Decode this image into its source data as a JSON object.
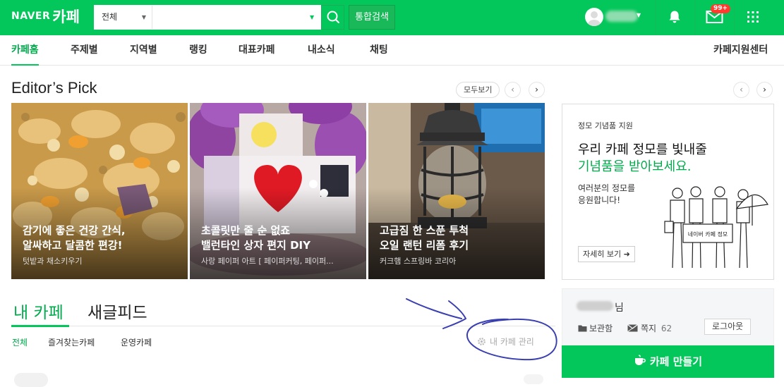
{
  "header": {
    "logo_naver": "NAVER",
    "logo_cafe": "카페",
    "search_category": "전체",
    "search_placeholder": "",
    "unified_search": "통합검색",
    "notification_badge": "99+",
    "brand_color": "#03c75a"
  },
  "nav": {
    "items": [
      "카페홈",
      "주제별",
      "지역별",
      "랭킹",
      "대표카페",
      "내소식",
      "채팅"
    ],
    "right": "카페지원센터"
  },
  "editors_pick": {
    "title": "Editor’s Pick",
    "view_all": "모두보기",
    "cards": [
      {
        "line1": "감기에 좋은 건강 간식,",
        "line2": "알싸하고 달콤한 편강!",
        "source": "텃밭과 채소키우기"
      },
      {
        "line1": "초콜릿만 줄 순 없죠",
        "line2": "밸런타인 상자 편지 DIY",
        "source": "사랑 페이퍼 아트 [ 페이퍼커팅, 페이퍼..."
      },
      {
        "line1": "고급짐 한 스푼 투척",
        "line2": "오일 랜턴 리폼 후기",
        "source": "커크햄 스프링바 코리아"
      }
    ]
  },
  "my_cafe": {
    "tab_mine": "내 카페",
    "tab_feed": "새글피드",
    "sub_tabs": [
      "전체",
      "즐겨찾는카페",
      "운영카페"
    ],
    "manage": "내 카페 관리"
  },
  "promo": {
    "label": "정모 기념품 지원",
    "headline1": "우리 카페 정모를 빛내줄",
    "headline2": "기념품을 받아보세요.",
    "desc1": "여러분의 정모를",
    "desc2": "응원합니다!",
    "more": "자세히 보기 ➜",
    "banner": "네이버 카페 정모"
  },
  "user": {
    "suffix": "님",
    "storage": "보관함",
    "notes": "쪽지",
    "notes_count": "62",
    "logout": "로그아웃",
    "create": "카페 만들기"
  }
}
